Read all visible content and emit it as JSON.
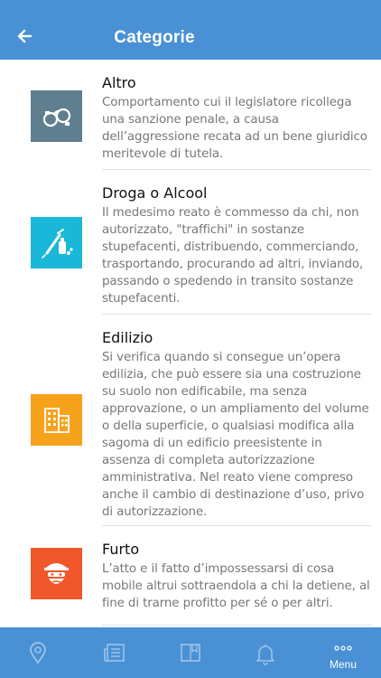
{
  "header": {
    "title": "Categorie"
  },
  "categories": [
    {
      "name": "Altro",
      "description": "Comportamento cui il legislatore ricollega una sanzione penale, a causa dell’aggressione recata ad un bene giuridico meritevole di tutela.",
      "icon": "handcuffs-icon",
      "color": "#5f7f8f"
    },
    {
      "name": "Droga o Alcool",
      "description": "Il medesimo reato è commesso da chi, non autorizzato, \"traffichi\" in sostanze stupefacenti, distribuendo, commerciando, trasportando, procurando ad altri, inviando, passando o spedendo in transito sostanze stupefacenti.",
      "icon": "syringe-bottle-icon",
      "color": "#1ab8d8"
    },
    {
      "name": "Edilizio",
      "description": "Si verifica quando si consegue un’opera edilizia, che può essere sia una costruzione su suolo non edificabile, ma senza approvazione, o un ampliamento del volume o della superficie, o qualsiasi modifica alla sagoma di un edificio preesistente in assenza di completa autorizzazione amministrativa. Nel reato viene compreso anche il cambio di destinazione d’uso, privo di autorizzazione.",
      "icon": "building-icon",
      "color": "#f7a21b"
    },
    {
      "name": "Furto",
      "description": "L’atto e il fatto d’impossessarsi di cosa mobile altrui sottraendola a chi la detiene, al fine di trarne profitto per sé o per altri.",
      "icon": "thief-icon",
      "color": "#f0572b"
    }
  ],
  "tabbar": {
    "tabs": [
      {
        "icon": "map-pin-icon"
      },
      {
        "icon": "news-icon"
      },
      {
        "icon": "book-icon"
      },
      {
        "icon": "bell-icon"
      },
      {
        "icon": "more-dots-icon",
        "label": "Menu"
      }
    ]
  },
  "colors": {
    "primary": "#4a90d4"
  }
}
